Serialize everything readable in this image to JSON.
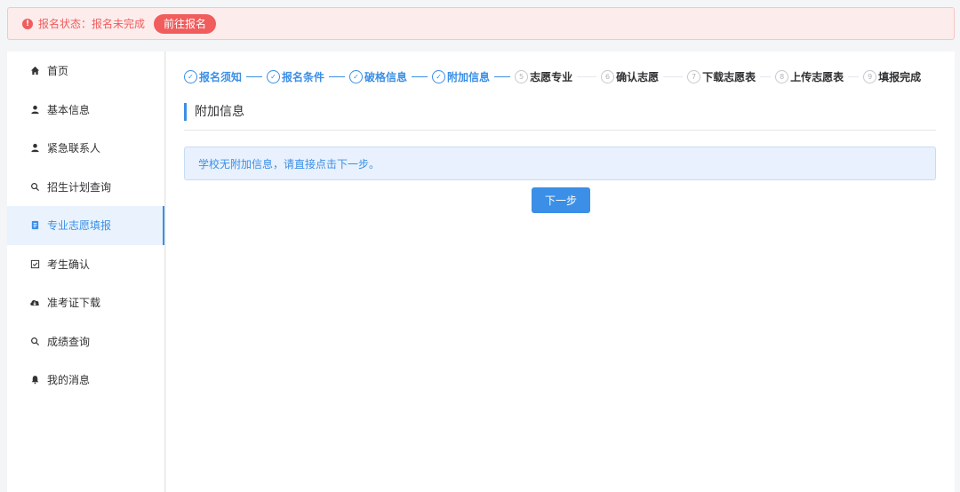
{
  "alert": {
    "icon": "alert-circle-icon",
    "text": "报名状态：报名未完成",
    "button_label": "前往报名",
    "color": "#f15c5c"
  },
  "sidebar": {
    "items": [
      {
        "label": "首页",
        "icon": "home-icon"
      },
      {
        "label": "基本信息",
        "icon": "user-icon"
      },
      {
        "label": "紧急联系人",
        "icon": "user-icon"
      },
      {
        "label": "招生计划查询",
        "icon": "search-icon"
      },
      {
        "label": "专业志愿填报",
        "icon": "document-icon",
        "active": true
      },
      {
        "label": "考生确认",
        "icon": "checkbox-icon"
      },
      {
        "label": "准考证下载",
        "icon": "cloud-download-icon"
      },
      {
        "label": "成绩查询",
        "icon": "search-icon"
      },
      {
        "label": "我的消息",
        "icon": "bell-icon"
      }
    ]
  },
  "steps": [
    {
      "label": "报名须知",
      "status": "done"
    },
    {
      "label": "报名条件",
      "status": "done"
    },
    {
      "label": "破格信息",
      "status": "done"
    },
    {
      "label": "附加信息",
      "status": "done"
    },
    {
      "label": "志愿专业",
      "num": "5",
      "status": "todo"
    },
    {
      "label": "确认志愿",
      "num": "6",
      "status": "todo"
    },
    {
      "label": "下载志愿表",
      "num": "7",
      "status": "todo"
    },
    {
      "label": "上传志愿表",
      "num": "8",
      "status": "todo"
    },
    {
      "label": "填报完成",
      "num": "9",
      "status": "todo"
    }
  ],
  "section": {
    "title": "附加信息",
    "info": "学校无附加信息，请直接点击下一步。",
    "next_label": "下一步"
  },
  "colors": {
    "accent": "#3b8fe6",
    "warning": "#f15c5c"
  }
}
